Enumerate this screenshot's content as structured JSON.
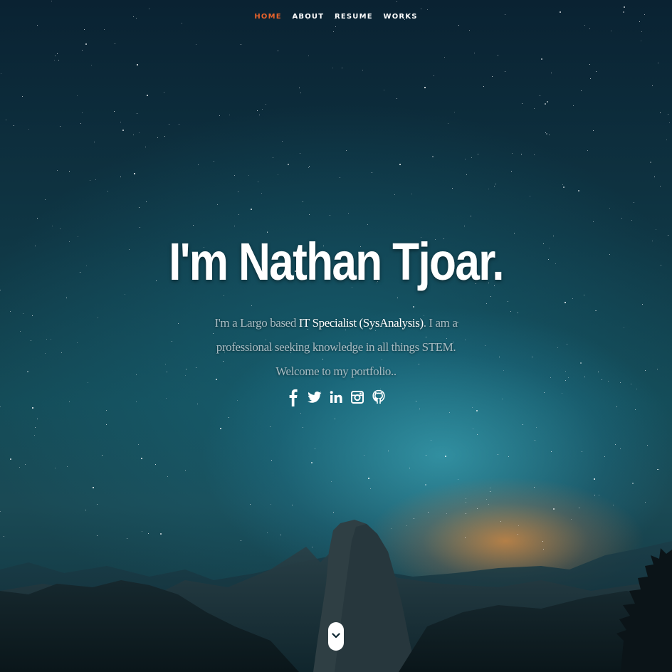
{
  "nav": {
    "items": [
      {
        "label": "HOME",
        "active": true
      },
      {
        "label": "ABOUT",
        "active": false
      },
      {
        "label": "RESUME",
        "active": false
      },
      {
        "label": "WORKS",
        "active": false
      }
    ]
  },
  "hero": {
    "headline": "I'm Nathan Tjoar.",
    "intro_prefix": "I'm a Largo based ",
    "intro_role": "IT Specialist (SysAnalysis)",
    "intro_suffix": ". I am a professional seeking knowledge in all things STEM. Welcome to my portfolio.."
  },
  "social": {
    "icons": [
      "facebook-icon",
      "twitter-icon",
      "linkedin-icon",
      "instagram-icon",
      "github-icon"
    ]
  },
  "scroll": {
    "icon": "chevron-down-icon"
  },
  "colors": {
    "accent": "#e8632b",
    "text": "#ffffff",
    "muted_text": "#a9bcc3"
  }
}
